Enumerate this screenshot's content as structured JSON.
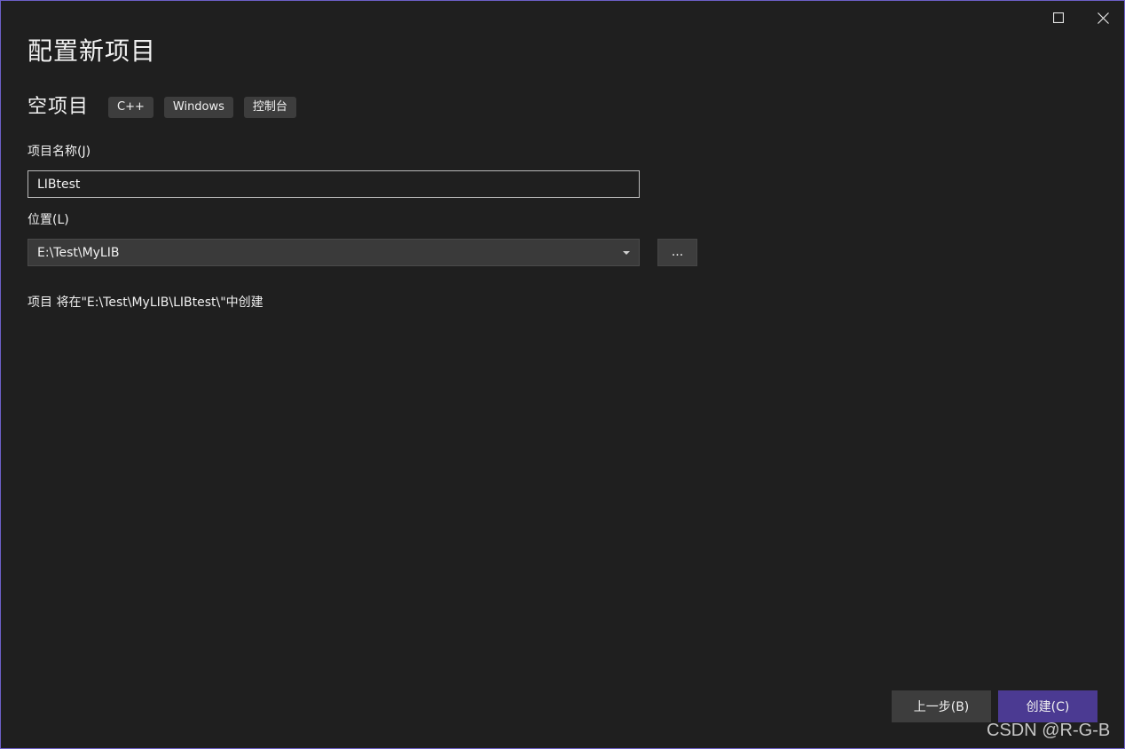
{
  "window": {
    "accent_border_color": "#6c5fc7",
    "controls": [
      "maximize-icon",
      "close-icon"
    ]
  },
  "header": {
    "title": "配置新项目"
  },
  "template": {
    "name": "空项目",
    "tags": [
      "C++",
      "Windows",
      "控制台"
    ]
  },
  "project_name": {
    "label": "项目名称(J)",
    "value": "LIBtest"
  },
  "location": {
    "label": "位置(L)",
    "value": "E:\\Test\\MyLIB",
    "browse_label": "..."
  },
  "info": {
    "path_text": "项目 将在\"E:\\Test\\MyLIB\\LIBtest\\\"中创建"
  },
  "footer": {
    "back_label": "上一步(B)",
    "create_label": "创建(C)",
    "create_color": "#4b3a92"
  },
  "watermark": {
    "text": "CSDN @R-G-B"
  }
}
